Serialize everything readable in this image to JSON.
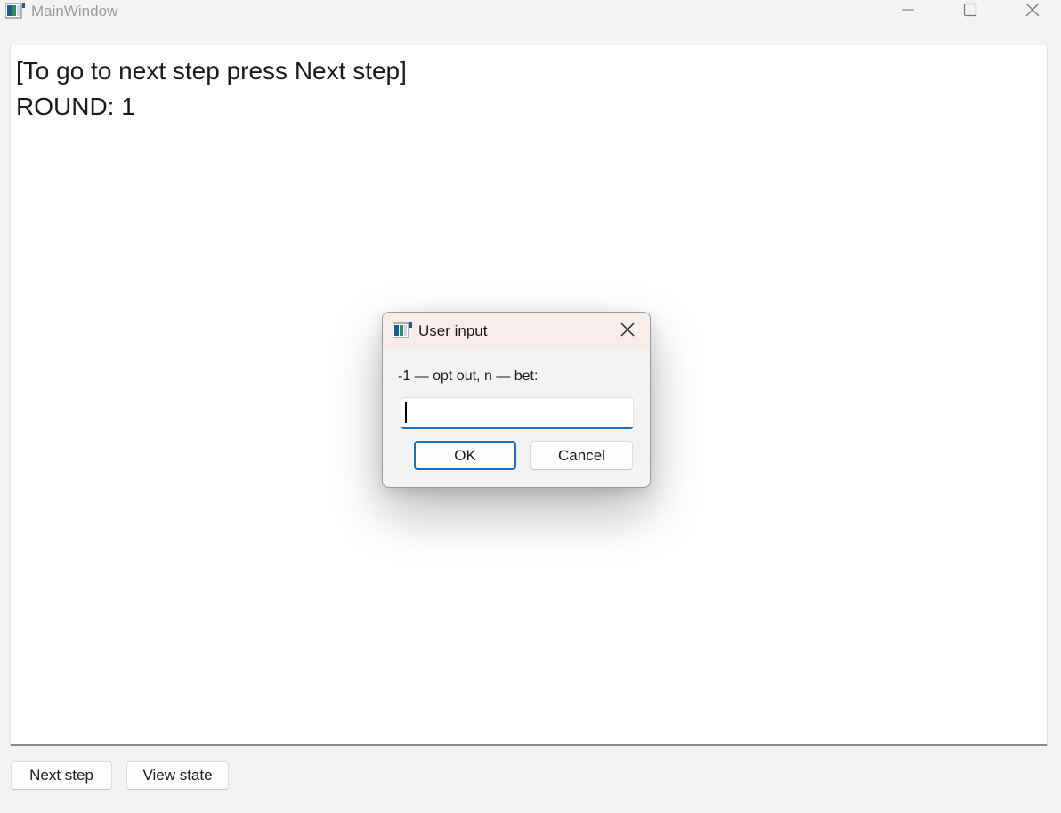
{
  "window": {
    "title": "MainWindow",
    "controls": {
      "minimize_icon": "minimize-icon",
      "maximize_icon": "maximize-icon",
      "close_icon": "close-icon"
    }
  },
  "main": {
    "lines": [
      "[To go to next step press Next step]",
      "ROUND: 1"
    ]
  },
  "footer": {
    "next_step_label": "Next step",
    "view_state_label": "View state"
  },
  "dialog": {
    "title": "User input",
    "prompt": "-1 — opt out, n — bet:",
    "input_value": "",
    "ok_label": "OK",
    "cancel_label": "Cancel"
  },
  "colors": {
    "accent": "#1f6fbf",
    "window_bg": "#f3f3f3",
    "dialog_titlebar_bg": "#f7eeec"
  }
}
